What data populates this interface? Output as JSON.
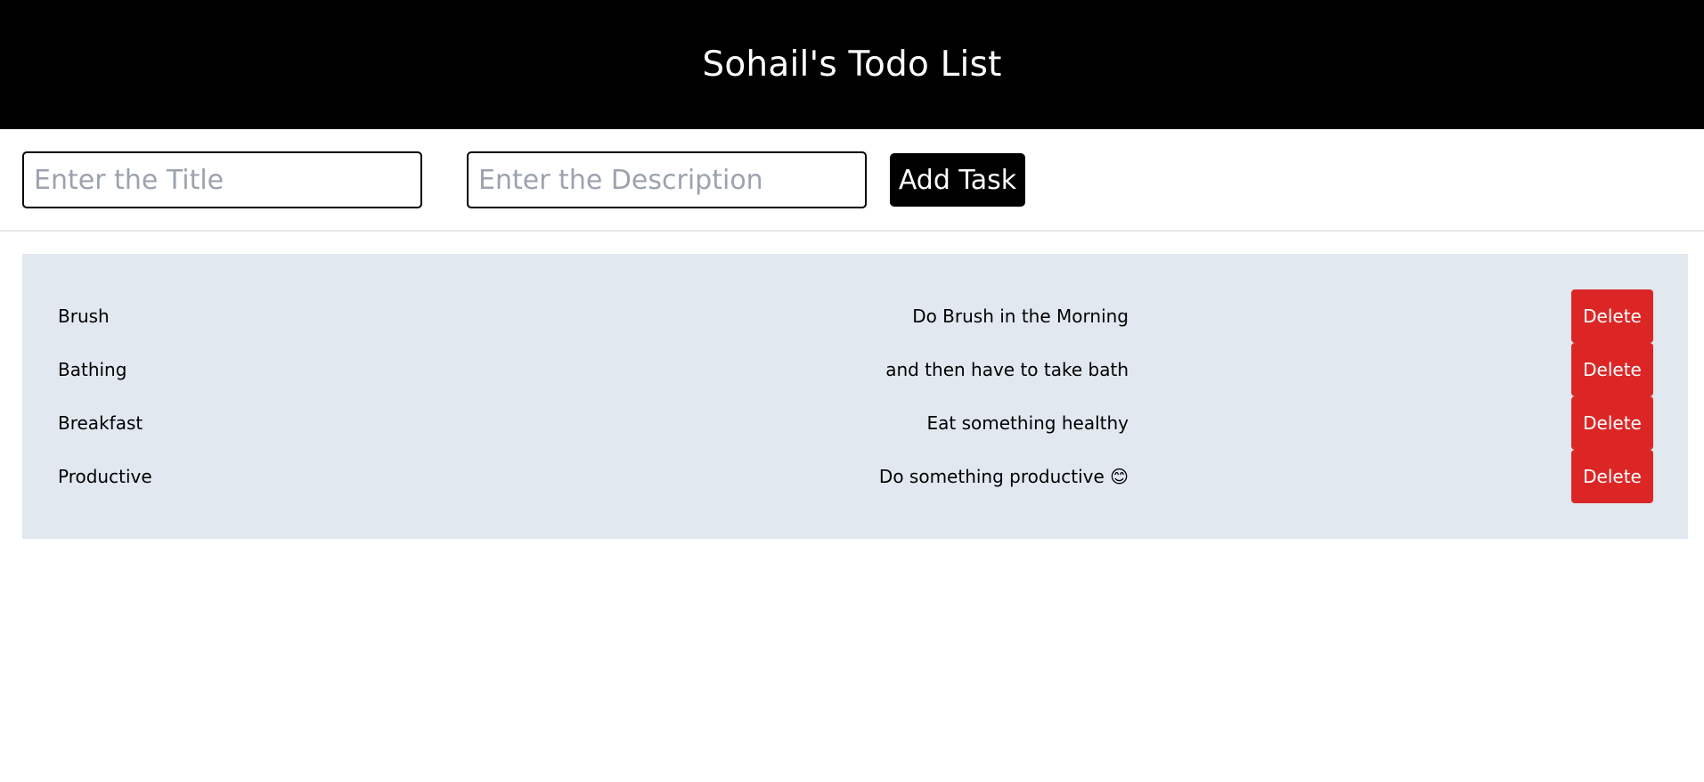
{
  "header": {
    "title": "Sohail's Todo List"
  },
  "form": {
    "title_placeholder": "Enter the Title",
    "title_value": "",
    "description_placeholder": "Enter the Description",
    "description_value": "",
    "add_label": "Add Task"
  },
  "tasks": [
    {
      "title": "Brush",
      "description": "Do Brush in the Morning",
      "delete_label": "Delete"
    },
    {
      "title": "Bathing",
      "description": "and then have to take bath",
      "delete_label": "Delete"
    },
    {
      "title": "Breakfast",
      "description": "Eat something healthy",
      "delete_label": "Delete"
    },
    {
      "title": "Productive",
      "description": "Do something productive 😊",
      "delete_label": "Delete"
    }
  ],
  "colors": {
    "header_bg": "#000000",
    "panel_bg": "#e2e8f0",
    "delete_bg": "#dc2626",
    "button_bg": "#000000"
  }
}
